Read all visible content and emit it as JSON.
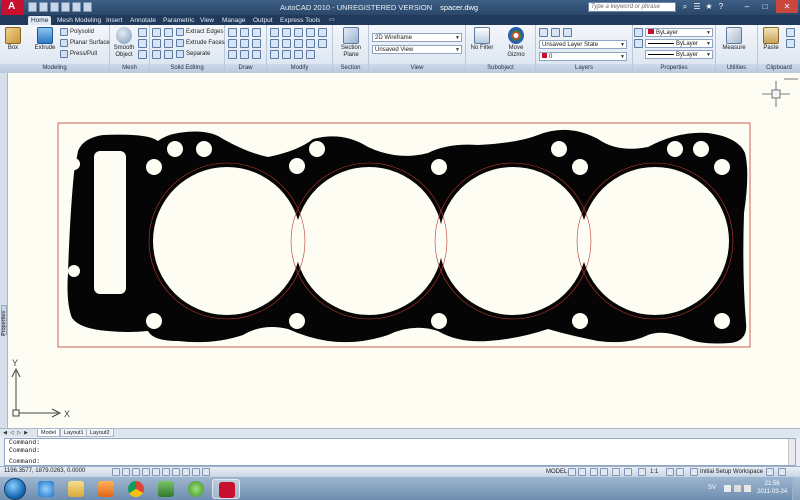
{
  "window": {
    "app_title": "AutoCAD 2010 - UNREGISTERED VERSION",
    "file_name": "spacer.dwg",
    "search_placeholder": "Type a keyword or phrase",
    "logo_letter": "A"
  },
  "ribbon_tabs": [
    "Home",
    "Mesh Modeling",
    "Insert",
    "Annotate",
    "Parametric",
    "View",
    "Manage",
    "Output",
    "Express Tools"
  ],
  "ribbon": {
    "modeling": {
      "label": "Modeling",
      "box": "Box",
      "extrude": "Extrude",
      "polysolid": "Polysolid",
      "planar_surface": "Planar Surface",
      "press_pull": "Press/Pull"
    },
    "mesh": {
      "label": "Mesh",
      "smooth_object": "Smooth Object"
    },
    "solid_editing": {
      "label": "Solid Editing",
      "extract_edges": "Extract Edges",
      "extrude_faces": "Extrude Faces",
      "separate": "Separate"
    },
    "draw": {
      "label": "Draw"
    },
    "modify": {
      "label": "Modify"
    },
    "section": {
      "label": "Section",
      "section_plane": "Section Plane"
    },
    "view": {
      "label": "View",
      "visual_style": "2D Wireframe",
      "saved_view": "Unsaved View"
    },
    "subobject": {
      "label": "Subobject",
      "no_filter": "No Filter",
      "move_gizmo": "Move Gizmo"
    },
    "layers": {
      "label": "Layers",
      "layer_state": "Unsaved Layer State",
      "current_layer": "0"
    },
    "properties": {
      "label": "Properties",
      "color": "ByLayer",
      "linetype": "ByLayer",
      "lineweight": "ByLayer"
    },
    "utilities": {
      "label": "Utilities",
      "measure": "Measure"
    },
    "clipboard": {
      "label": "Clipboard",
      "paste": "Paste"
    }
  },
  "palette": {
    "label": "Properties"
  },
  "ucs": {
    "x_label": "X",
    "y_label": "Y"
  },
  "layout_tabs": [
    "Model",
    "Layout1",
    "Layout2"
  ],
  "command": {
    "history": [
      "Command:",
      "Command:"
    ],
    "prompt": "Command:"
  },
  "status": {
    "coordinates": "1196.3577, 1879.0263, 0.0000",
    "model_label": "MODEL",
    "scale": "1:1",
    "workspace": "Initial Setup Workspace"
  },
  "taskbar": {
    "language": "SV",
    "time": "21:56",
    "date": "2011-03-24"
  },
  "colors": {
    "gasket": "#050505",
    "bore_outline": "#c0392b",
    "canvas": "#fdfdf4",
    "brand_red": "#c8102e"
  },
  "icons": [
    "autocad-logo-icon",
    "search-icon",
    "help-icon",
    "minimize-icon",
    "maximize-icon",
    "close-icon",
    "start-orb-icon"
  ]
}
